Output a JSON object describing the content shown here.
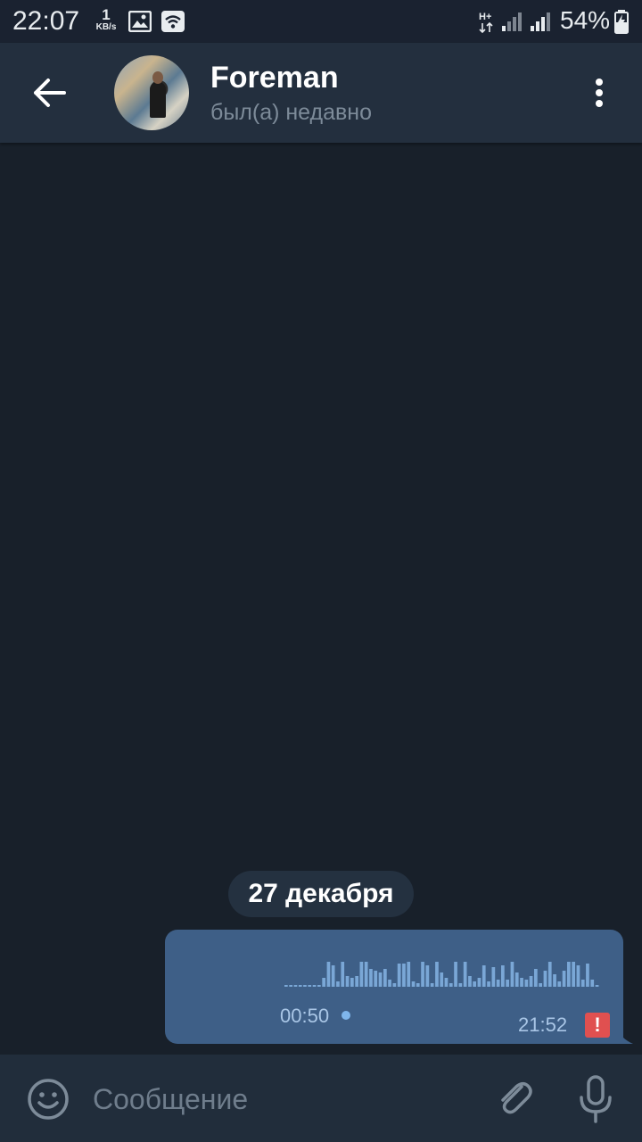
{
  "status_bar": {
    "time": "22:07",
    "speed_value": "1",
    "speed_unit": "KB/s",
    "network_type": "H+",
    "battery": "54%"
  },
  "header": {
    "chat_name": "Foreman",
    "chat_status": "был(а) недавно"
  },
  "messages": {
    "date_separator": "27 декабря",
    "voice_message": {
      "duration": "00:50",
      "time": "21:52",
      "error_mark": "!"
    }
  },
  "input": {
    "placeholder": "Сообщение"
  },
  "colors": {
    "background": "#18202a",
    "header": "#232f3e",
    "bubble": "#3e5f87",
    "error": "#e05050"
  },
  "icons": [
    "back-arrow-icon",
    "more-vert-icon",
    "emoji-icon",
    "attach-icon",
    "mic-icon",
    "gallery-icon",
    "wifi-icon",
    "signal-icon",
    "battery-icon"
  ]
}
